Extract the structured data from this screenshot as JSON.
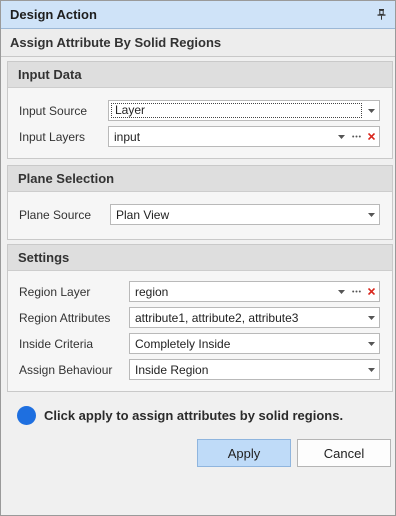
{
  "panel": {
    "title": "Design Action",
    "subtitle": "Assign Attribute By Solid Regions"
  },
  "groups": {
    "input_data": {
      "title": "Input Data",
      "rows": [
        {
          "label": "Input Source",
          "value": "Layer"
        },
        {
          "label": "Input Layers",
          "value": "input"
        }
      ]
    },
    "plane_selection": {
      "title": "Plane Selection",
      "rows": [
        {
          "label": "Plane Source",
          "value": "Plan View"
        }
      ]
    },
    "settings": {
      "title": "Settings",
      "rows": [
        {
          "label": "Region Layer",
          "value": "region"
        },
        {
          "label": "Region Attributes",
          "value": "attribute1, attribute2, attribute3"
        },
        {
          "label": "Inside Criteria",
          "value": "Completely Inside"
        },
        {
          "label": "Assign Behaviour",
          "value": "Inside Region"
        }
      ]
    }
  },
  "info": {
    "text": "Click apply to assign attributes by solid regions."
  },
  "buttons": {
    "apply": "Apply",
    "cancel": "Cancel"
  },
  "colors": {
    "titlebar": "#cfe3f8",
    "info_dot": "#1e6fe0",
    "apply_button": "#bfdbf8",
    "clear_icon": "#d9261c"
  }
}
